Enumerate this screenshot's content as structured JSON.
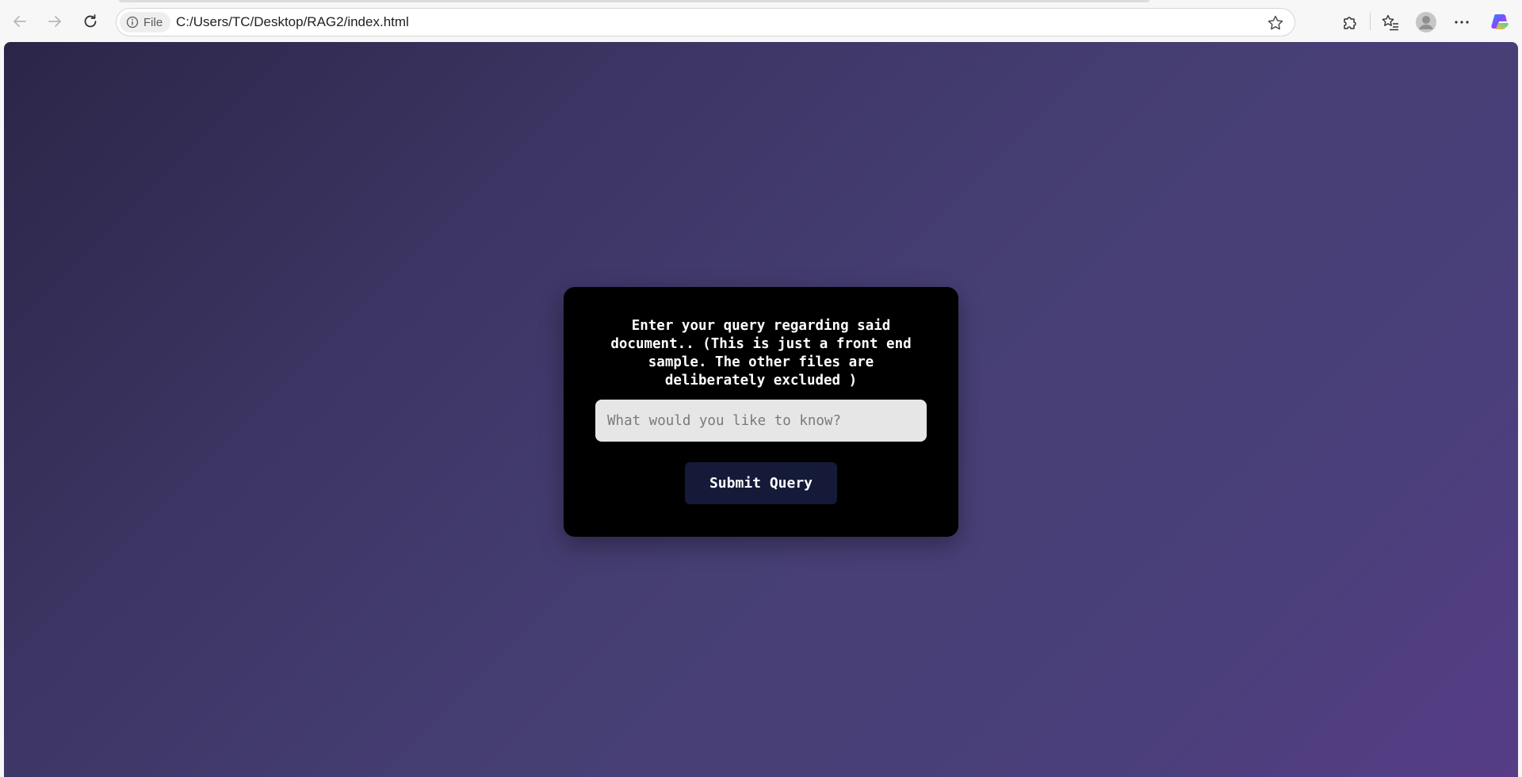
{
  "browser": {
    "site_info_label": "File",
    "url": "C:/Users/TC/Desktop/RAG2/index.html",
    "icons": {
      "back": "back-arrow-icon",
      "forward": "forward-arrow-icon",
      "refresh": "refresh-icon",
      "info": "info-icon",
      "favorite": "star-icon",
      "extensions": "puzzle-icon",
      "favorites": "favorites-list-icon",
      "profile": "profile-avatar-icon",
      "menu": "more-dots-icon",
      "copilot": "copilot-icon"
    }
  },
  "page": {
    "prompt": "Enter your query regarding said document.. (This is just a front end sample. The other files are deliberately excluded )",
    "input_placeholder": "What would you like to know?",
    "input_value": "",
    "submit_label": "Submit Query"
  },
  "colors": {
    "card_bg": "#000000",
    "button_bg": "#141a38",
    "input_bg": "#e6e6e6",
    "gradient_start": "#2b2648",
    "gradient_end": "#563d86"
  }
}
